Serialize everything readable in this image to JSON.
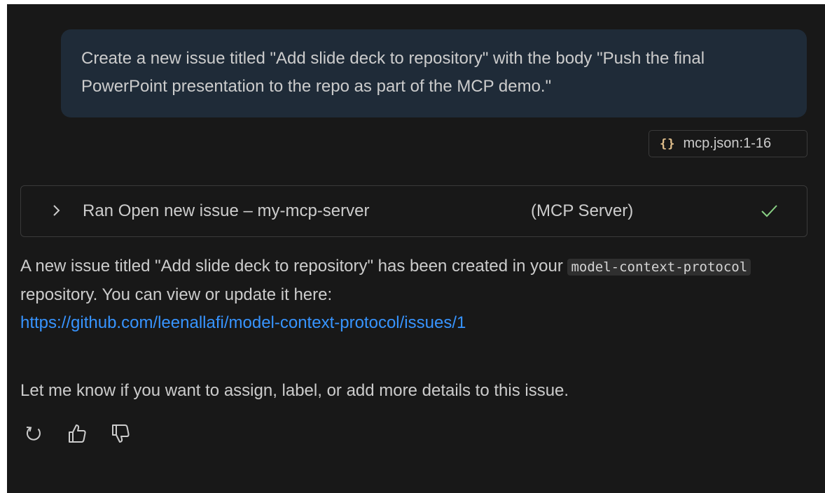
{
  "user_message": {
    "text": "Create a new issue titled \"Add slide deck to repository\" with the body \"Push the final PowerPoint presentation to the repo as part of the MCP demo.\""
  },
  "attachment": {
    "icon": "json-braces-icon",
    "name": "mcp.json",
    "range": ":1-16"
  },
  "tool_call": {
    "title": "Ran Open new issue – my-mcp-server",
    "source": "(MCP Server)",
    "status_icon": "checkmark-icon"
  },
  "response": {
    "text_before_code": "A new issue titled \"Add slide deck to repository\" has been created in your ",
    "code": "model-context-protocol",
    "text_after_code": " repository. You can view or update it here:",
    "link": "https://github.com/leenallafi/model-context-protocol/issues/1",
    "followup": "Let me know if you want to assign, label, or add more details to this issue."
  },
  "actions": [
    {
      "icon": "retry-icon"
    },
    {
      "icon": "thumbs-up-icon"
    },
    {
      "icon": "thumbs-down-icon"
    }
  ],
  "colors": {
    "background": "#181818",
    "user_bubble": "#1f2b38",
    "link": "#3794ff",
    "success": "#89d185",
    "json_icon": "#e2c08d"
  }
}
